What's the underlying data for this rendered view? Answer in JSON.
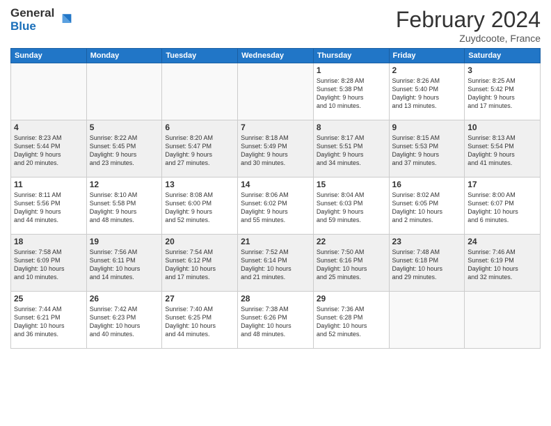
{
  "header": {
    "logo_line1": "General",
    "logo_line2": "Blue",
    "month": "February 2024",
    "location": "Zuydcoote, France"
  },
  "weekdays": [
    "Sunday",
    "Monday",
    "Tuesday",
    "Wednesday",
    "Thursday",
    "Friday",
    "Saturday"
  ],
  "weeks": [
    {
      "shaded": false,
      "days": [
        {
          "num": "",
          "info": ""
        },
        {
          "num": "",
          "info": ""
        },
        {
          "num": "",
          "info": ""
        },
        {
          "num": "",
          "info": ""
        },
        {
          "num": "1",
          "info": "Sunrise: 8:28 AM\nSunset: 5:38 PM\nDaylight: 9 hours\nand 10 minutes."
        },
        {
          "num": "2",
          "info": "Sunrise: 8:26 AM\nSunset: 5:40 PM\nDaylight: 9 hours\nand 13 minutes."
        },
        {
          "num": "3",
          "info": "Sunrise: 8:25 AM\nSunset: 5:42 PM\nDaylight: 9 hours\nand 17 minutes."
        }
      ]
    },
    {
      "shaded": true,
      "days": [
        {
          "num": "4",
          "info": "Sunrise: 8:23 AM\nSunset: 5:44 PM\nDaylight: 9 hours\nand 20 minutes."
        },
        {
          "num": "5",
          "info": "Sunrise: 8:22 AM\nSunset: 5:45 PM\nDaylight: 9 hours\nand 23 minutes."
        },
        {
          "num": "6",
          "info": "Sunrise: 8:20 AM\nSunset: 5:47 PM\nDaylight: 9 hours\nand 27 minutes."
        },
        {
          "num": "7",
          "info": "Sunrise: 8:18 AM\nSunset: 5:49 PM\nDaylight: 9 hours\nand 30 minutes."
        },
        {
          "num": "8",
          "info": "Sunrise: 8:17 AM\nSunset: 5:51 PM\nDaylight: 9 hours\nand 34 minutes."
        },
        {
          "num": "9",
          "info": "Sunrise: 8:15 AM\nSunset: 5:53 PM\nDaylight: 9 hours\nand 37 minutes."
        },
        {
          "num": "10",
          "info": "Sunrise: 8:13 AM\nSunset: 5:54 PM\nDaylight: 9 hours\nand 41 minutes."
        }
      ]
    },
    {
      "shaded": false,
      "days": [
        {
          "num": "11",
          "info": "Sunrise: 8:11 AM\nSunset: 5:56 PM\nDaylight: 9 hours\nand 44 minutes."
        },
        {
          "num": "12",
          "info": "Sunrise: 8:10 AM\nSunset: 5:58 PM\nDaylight: 9 hours\nand 48 minutes."
        },
        {
          "num": "13",
          "info": "Sunrise: 8:08 AM\nSunset: 6:00 PM\nDaylight: 9 hours\nand 52 minutes."
        },
        {
          "num": "14",
          "info": "Sunrise: 8:06 AM\nSunset: 6:02 PM\nDaylight: 9 hours\nand 55 minutes."
        },
        {
          "num": "15",
          "info": "Sunrise: 8:04 AM\nSunset: 6:03 PM\nDaylight: 9 hours\nand 59 minutes."
        },
        {
          "num": "16",
          "info": "Sunrise: 8:02 AM\nSunset: 6:05 PM\nDaylight: 10 hours\nand 2 minutes."
        },
        {
          "num": "17",
          "info": "Sunrise: 8:00 AM\nSunset: 6:07 PM\nDaylight: 10 hours\nand 6 minutes."
        }
      ]
    },
    {
      "shaded": true,
      "days": [
        {
          "num": "18",
          "info": "Sunrise: 7:58 AM\nSunset: 6:09 PM\nDaylight: 10 hours\nand 10 minutes."
        },
        {
          "num": "19",
          "info": "Sunrise: 7:56 AM\nSunset: 6:11 PM\nDaylight: 10 hours\nand 14 minutes."
        },
        {
          "num": "20",
          "info": "Sunrise: 7:54 AM\nSunset: 6:12 PM\nDaylight: 10 hours\nand 17 minutes."
        },
        {
          "num": "21",
          "info": "Sunrise: 7:52 AM\nSunset: 6:14 PM\nDaylight: 10 hours\nand 21 minutes."
        },
        {
          "num": "22",
          "info": "Sunrise: 7:50 AM\nSunset: 6:16 PM\nDaylight: 10 hours\nand 25 minutes."
        },
        {
          "num": "23",
          "info": "Sunrise: 7:48 AM\nSunset: 6:18 PM\nDaylight: 10 hours\nand 29 minutes."
        },
        {
          "num": "24",
          "info": "Sunrise: 7:46 AM\nSunset: 6:19 PM\nDaylight: 10 hours\nand 32 minutes."
        }
      ]
    },
    {
      "shaded": false,
      "days": [
        {
          "num": "25",
          "info": "Sunrise: 7:44 AM\nSunset: 6:21 PM\nDaylight: 10 hours\nand 36 minutes."
        },
        {
          "num": "26",
          "info": "Sunrise: 7:42 AM\nSunset: 6:23 PM\nDaylight: 10 hours\nand 40 minutes."
        },
        {
          "num": "27",
          "info": "Sunrise: 7:40 AM\nSunset: 6:25 PM\nDaylight: 10 hours\nand 44 minutes."
        },
        {
          "num": "28",
          "info": "Sunrise: 7:38 AM\nSunset: 6:26 PM\nDaylight: 10 hours\nand 48 minutes."
        },
        {
          "num": "29",
          "info": "Sunrise: 7:36 AM\nSunset: 6:28 PM\nDaylight: 10 hours\nand 52 minutes."
        },
        {
          "num": "",
          "info": ""
        },
        {
          "num": "",
          "info": ""
        }
      ]
    }
  ]
}
